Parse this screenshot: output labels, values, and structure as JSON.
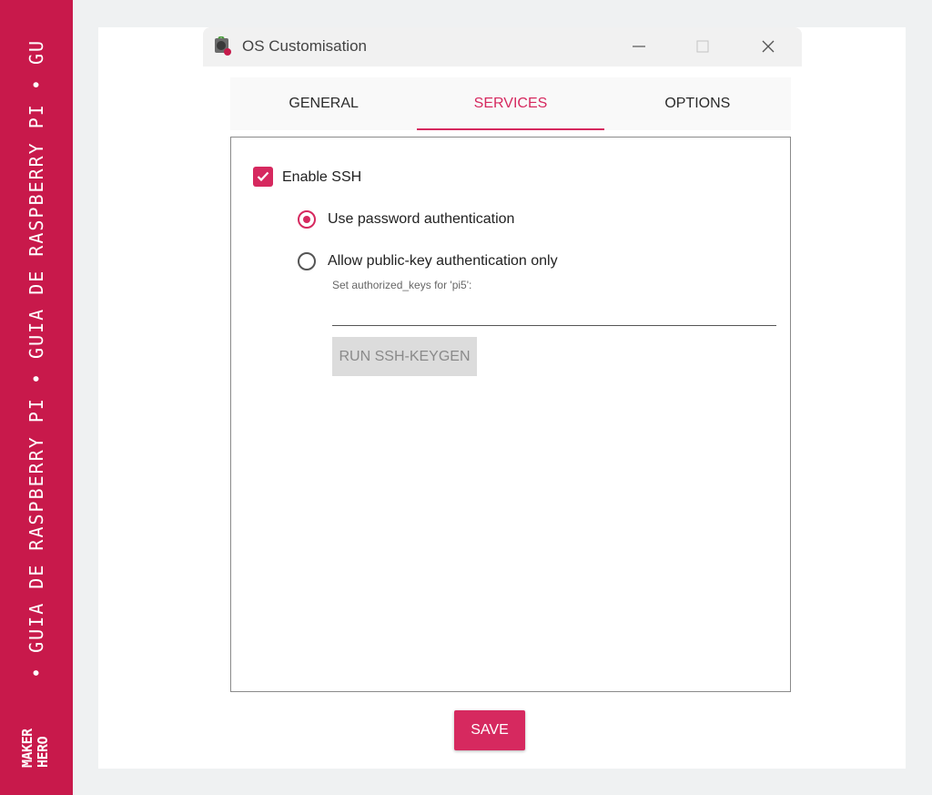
{
  "banner": {
    "text": "• GUIA DE RASPBERRY PI • GUIA DE RASPBERRY PI • GU",
    "logo_line1": "MAKER",
    "logo_line2": "HERO"
  },
  "window": {
    "title": "OS Customisation",
    "controls": [
      "minimize-icon",
      "maximize-icon",
      "close-icon"
    ]
  },
  "tabs": [
    {
      "label": "GENERAL",
      "active": false
    },
    {
      "label": "SERVICES",
      "active": true
    },
    {
      "label": "OPTIONS",
      "active": false
    }
  ],
  "services": {
    "enable_ssh_label": "Enable SSH",
    "enable_ssh_checked": true,
    "password_auth_label": "Use password authentication",
    "password_auth_selected": true,
    "pubkey_auth_label": "Allow public-key authentication only",
    "pubkey_auth_selected": false,
    "authorized_keys_label": "Set authorized_keys for 'pi5':",
    "authorized_keys_value": "",
    "keygen_button_label": "RUN SSH-KEYGEN"
  },
  "save_label": "SAVE",
  "colors": {
    "accent": "#d6295f",
    "banner": "#c8194b",
    "disabled_button": "#dcdcdc"
  }
}
